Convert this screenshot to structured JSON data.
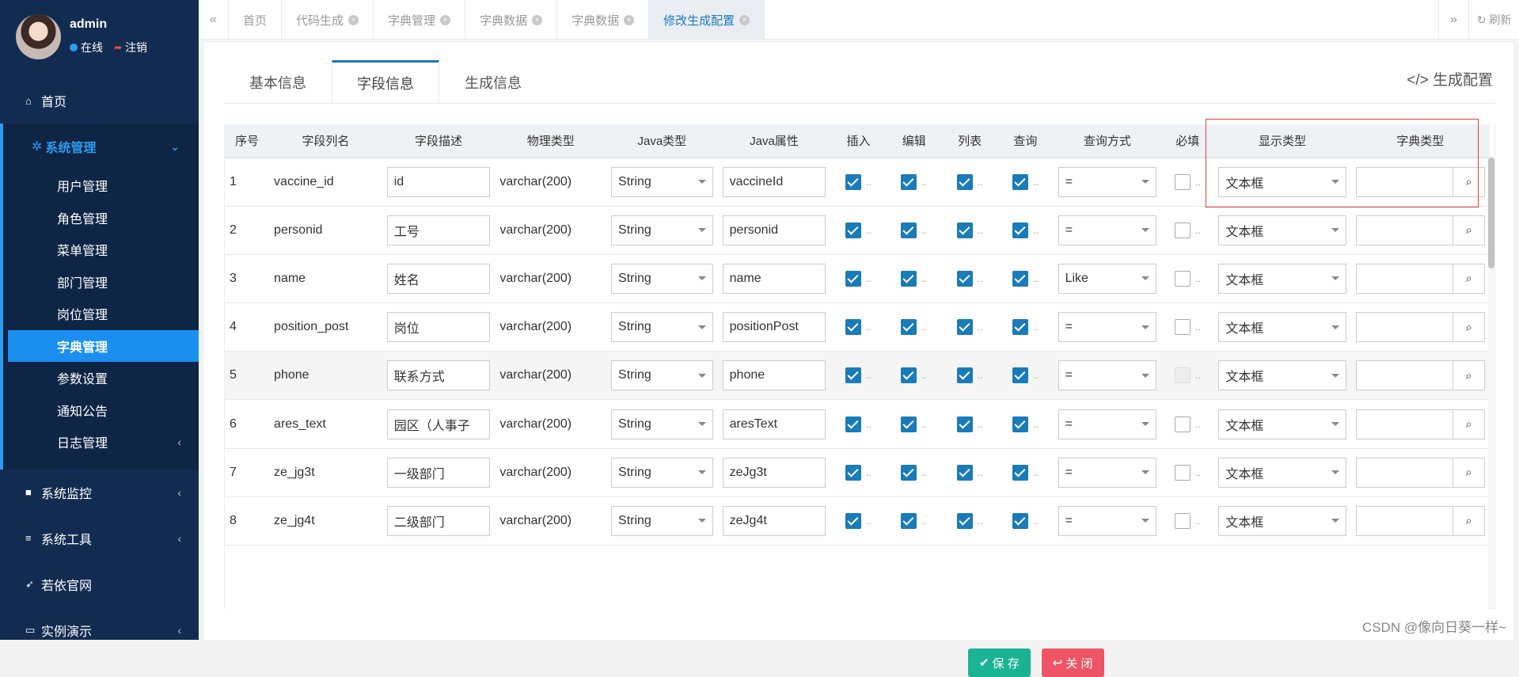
{
  "user": {
    "name": "admin",
    "status": "在线",
    "logout": "注销"
  },
  "nav": {
    "home": "首页",
    "system": "系统管理",
    "sub_items": [
      "用户管理",
      "角色管理",
      "菜单管理",
      "部门管理",
      "岗位管理",
      "字典管理",
      "参数设置",
      "通知公告",
      "日志管理"
    ],
    "monitor": "系统监控",
    "tools": "系统工具",
    "site": "若依官网",
    "demo": "实例演示"
  },
  "page_tabs": [
    {
      "label": "首页",
      "closable": false
    },
    {
      "label": "代码生成",
      "closable": true
    },
    {
      "label": "字典管理",
      "closable": true
    },
    {
      "label": "字典数据",
      "closable": true
    },
    {
      "label": "字典数据",
      "closable": true
    },
    {
      "label": "修改生成配置",
      "closable": true,
      "active": true
    }
  ],
  "refresh": "刷新",
  "content_tabs": [
    "基本信息",
    "字段信息",
    "生成信息"
  ],
  "generate_config": "生成配置",
  "columns": [
    "序号",
    "字段列名",
    "字段描述",
    "物理类型",
    "Java类型",
    "Java属性",
    "插入",
    "编辑",
    "列表",
    "查询",
    "查询方式",
    "必填",
    "显示类型",
    "字典类型"
  ],
  "rows": [
    {
      "no": "1",
      "col": "vaccine_id",
      "desc": "id",
      "phys": "varchar(200)",
      "jtype": "String",
      "jattr": "vaccineId",
      "query": "=",
      "display": "文本框"
    },
    {
      "no": "2",
      "col": "personid",
      "desc": "工号",
      "phys": "varchar(200)",
      "jtype": "String",
      "jattr": "personid",
      "query": "=",
      "display": "文本框"
    },
    {
      "no": "3",
      "col": "name",
      "desc": "姓名",
      "phys": "varchar(200)",
      "jtype": "String",
      "jattr": "name",
      "query": "Like",
      "display": "文本框"
    },
    {
      "no": "4",
      "col": "position_post",
      "desc": "岗位",
      "phys": "varchar(200)",
      "jtype": "String",
      "jattr": "positionPost",
      "query": "=",
      "display": "文本框"
    },
    {
      "no": "5",
      "col": "phone",
      "desc": "联系方式",
      "phys": "varchar(200)",
      "jtype": "String",
      "jattr": "phone",
      "query": "=",
      "display": "文本框"
    },
    {
      "no": "6",
      "col": "ares_text",
      "desc": "园区（人事子",
      "phys": "varchar(200)",
      "jtype": "String",
      "jattr": "aresText",
      "query": "=",
      "display": "文本框"
    },
    {
      "no": "7",
      "col": "ze_jg3t",
      "desc": "一级部门",
      "phys": "varchar(200)",
      "jtype": "String",
      "jattr": "zeJg3t",
      "query": "=",
      "display": "文本框"
    },
    {
      "no": "8",
      "col": "ze_jg4t",
      "desc": "二级部门",
      "phys": "varchar(200)",
      "jtype": "String",
      "jattr": "zeJg4t",
      "query": "=",
      "display": "文本框"
    }
  ],
  "buttons": {
    "save": "保 存",
    "close": "关 闭"
  },
  "watermark": "CSDN @像向日葵一样~",
  "colors": {
    "sidebar": "#122c51",
    "accent": "#1a7bb9",
    "active_nav": "#1b8ff0",
    "save": "#1ab394",
    "close": "#ed5565"
  }
}
